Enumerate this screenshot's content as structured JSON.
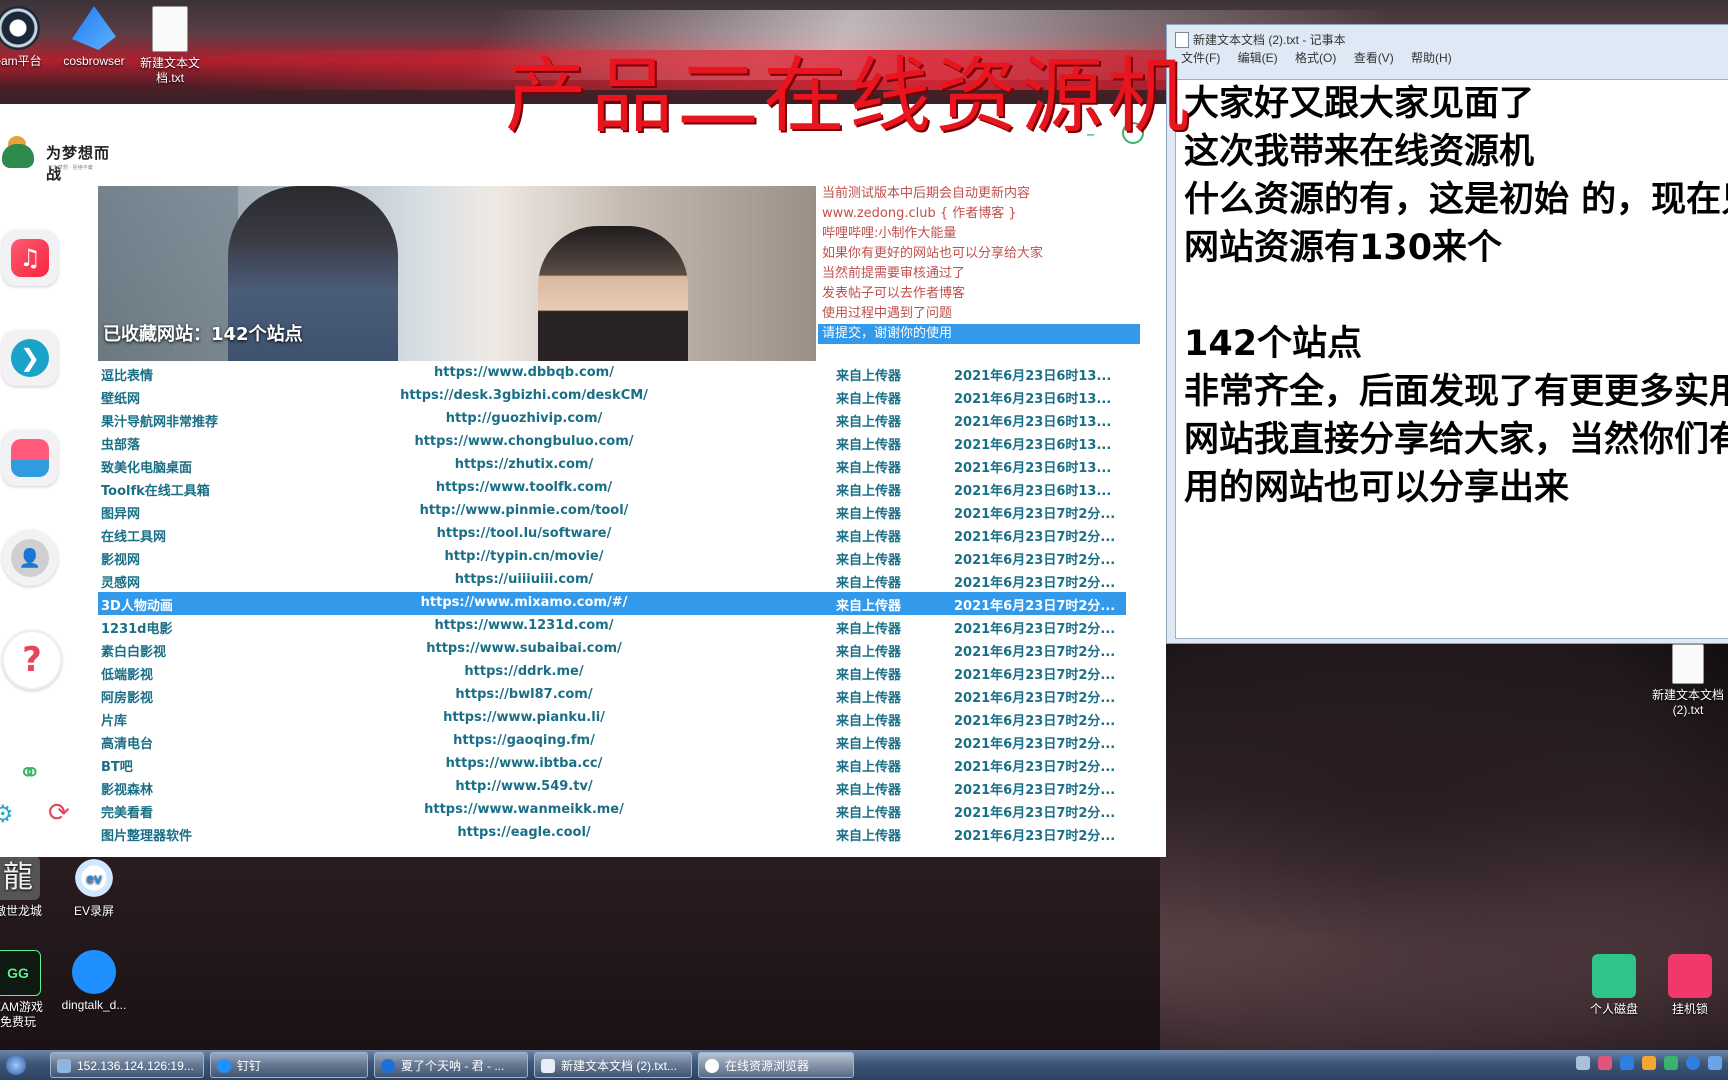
{
  "desktop_icons": [
    {
      "label": "eam平台",
      "icon": "steam-icon"
    },
    {
      "label": "cosbrowser",
      "icon": "cosbrowser-icon"
    },
    {
      "label": "新建文本文档.txt",
      "icon": "text-file-icon"
    },
    {
      "label": "傲世龙城",
      "icon": "game-icon"
    },
    {
      "label": "EV录屏",
      "icon": "ev-recorder-icon"
    },
    {
      "label": "EAM游戏免费玩",
      "icon": "game-platform-icon"
    },
    {
      "label": "dingtalk_d...",
      "icon": "dingtalk-icon"
    },
    {
      "label": "新建文本文档 (2).txt",
      "icon": "text-file-icon"
    },
    {
      "label": "个人磁盘",
      "icon": "disk-icon"
    },
    {
      "label": "挂机锁",
      "icon": "lock-icon"
    }
  ],
  "overlay_title": "产品二在线资源机",
  "app": {
    "logo_text": "为梦想而战",
    "logo_subtext": "只为梦想 · 拒绝平庸",
    "banner_title": "已收藏网站：142个站点",
    "notice_lines": [
      "当前测试版本中后期会自动更新内容",
      "www.zedong.club { 作者博客 }",
      "哔哩哔哩:小制作大能量",
      "如果你有更好的网站也可以分享给大家",
      "当然前提需要审核通过了",
      "发表帖子可以去作者博客",
      "使用过程中遇到了问题",
      "请提交，谢谢你的使用"
    ],
    "rows": [
      {
        "name": "逗比表情",
        "url": "https://www.dbbqb.com/",
        "source": "来自上传器",
        "time": "2021年6月23日6时13..."
      },
      {
        "name": "壁纸网",
        "url": "https://desk.3gbizhi.com/deskCM/",
        "source": "来自上传器",
        "time": "2021年6月23日6时13..."
      },
      {
        "name": "果汁导航网非常推荐",
        "url": "http://guozhivip.com/",
        "source": "来自上传器",
        "time": "2021年6月23日6时13..."
      },
      {
        "name": "虫部落",
        "url": "https://www.chongbuluo.com/",
        "source": "来自上传器",
        "time": "2021年6月23日6时13..."
      },
      {
        "name": "致美化电脑桌面",
        "url": "https://zhutix.com/",
        "source": "来自上传器",
        "time": "2021年6月23日6时13..."
      },
      {
        "name": "Toolfk在线工具箱",
        "url": "https://www.toolfk.com/",
        "source": "来自上传器",
        "time": "2021年6月23日6时13..."
      },
      {
        "name": "图异网",
        "url": "http://www.pinmie.com/tool/",
        "source": "来自上传器",
        "time": "2021年6月23日7时2分..."
      },
      {
        "name": "在线工具网",
        "url": "https://tool.lu/software/",
        "source": "来自上传器",
        "time": "2021年6月23日7时2分..."
      },
      {
        "name": "影视网",
        "url": "http://typin.cn/movie/",
        "source": "来自上传器",
        "time": "2021年6月23日7时2分..."
      },
      {
        "name": "灵感网",
        "url": "https://uiiiuiii.com/",
        "source": "来自上传器",
        "time": "2021年6月23日7时2分..."
      },
      {
        "name": "3D人物动画",
        "url": "https://www.mixamo.com/#/",
        "source": "来自上传器",
        "time": "2021年6月23日7时2分..."
      },
      {
        "name": "1231d电影",
        "url": "https://www.1231d.com/",
        "source": "来自上传器",
        "time": "2021年6月23日7时2分..."
      },
      {
        "name": "素白白影视",
        "url": "https://www.subaibai.com/",
        "source": "来自上传器",
        "time": "2021年6月23日7时2分..."
      },
      {
        "name": "低端影视",
        "url": "https://ddrk.me/",
        "source": "来自上传器",
        "time": "2021年6月23日7时2分..."
      },
      {
        "name": "阿房影视",
        "url": "https://bwl87.com/",
        "source": "来自上传器",
        "time": "2021年6月23日7时2分..."
      },
      {
        "name": "片库",
        "url": "https://www.pianku.li/",
        "source": "来自上传器",
        "time": "2021年6月23日7时2分..."
      },
      {
        "name": "高清电台",
        "url": "https://gaoqing.fm/",
        "source": "来自上传器",
        "time": "2021年6月23日7时2分..."
      },
      {
        "name": "BT吧",
        "url": "https://www.ibtba.cc/",
        "source": "来自上传器",
        "time": "2021年6月23日7时2分..."
      },
      {
        "name": "影视森林",
        "url": "http://www.549.tv/",
        "source": "来自上传器",
        "time": "2021年6月23日7时2分..."
      },
      {
        "name": "完美看看",
        "url": "https://www.wanmeikk.me/",
        "source": "来自上传器",
        "time": "2021年6月23日7时2分..."
      },
      {
        "name": "图片整理器软件",
        "url": "https://eagle.cool/",
        "source": "来自上传器",
        "time": "2021年6月23日7时2分..."
      }
    ],
    "selected_row": "3D人物动画",
    "sidebar_icons": [
      "music-icon",
      "play-icon",
      "inbox-icon",
      "user-icon",
      "help-icon",
      "share-icon",
      "settings-icon",
      "refresh-icon"
    ]
  },
  "notepad": {
    "title": "新建文本文档 (2).txt - 记事本",
    "menu": [
      "文件(F)",
      "编辑(E)",
      "格式(O)",
      "查看(V)",
      "帮助(H)"
    ],
    "lines": [
      "大家好又跟大家见面了",
      "这次我带来在线资源机",
      "什么资源的有，这是初始 的，现在只",
      "网站资源有130来个",
      "",
      "142个站点",
      "非常齐全，后面发现了有更更多实用",
      "网站我直接分享给大家，当然你们有",
      "用的网站也可以分享出来"
    ]
  },
  "taskbar": {
    "items": [
      {
        "label": "152.136.124.126:19...",
        "icon": "remote-desktop-icon"
      },
      {
        "label": "钉钉",
        "icon": "dingtalk-icon"
      },
      {
        "label": "夏了个天呐 - 君 - ...",
        "icon": "kugou-icon"
      },
      {
        "label": "新建文本文档 (2).txt...",
        "icon": "notepad-icon"
      },
      {
        "label": "在线资源浏览器",
        "icon": "cloud-icon"
      }
    ]
  },
  "colors": {
    "accent_selection": "#3399ea",
    "row_text": "#1a6f86",
    "notice_text": "#c0504d",
    "overlay_red": "#e8151e"
  }
}
